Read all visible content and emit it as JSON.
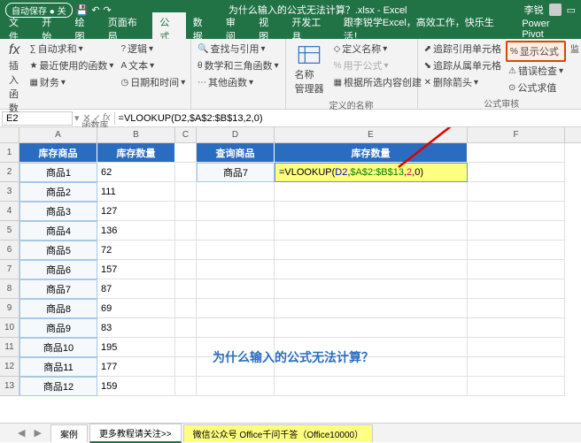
{
  "titlebar": {
    "autosave": "自动保存 ● 关",
    "filename": "为什么输入的公式无法计算？.xlsx - Excel",
    "user": "李锐"
  },
  "menu": {
    "file": "文件",
    "home": "开始",
    "insert": "绘图",
    "layout": "页面布局",
    "formula": "公式",
    "data": "数据",
    "review": "审阅",
    "view": "视图",
    "dev": "开发工具",
    "custom": "跟李锐学Excel，高效工作，快乐生活！",
    "power": "Power Pivot"
  },
  "ribbon": {
    "insertfn": "插入函数",
    "autosum": "自动求和",
    "recent": "最近使用的函数",
    "financial": "财务",
    "logical": "逻辑",
    "text": "文本",
    "date": "日期和时间",
    "lookup": "查找与引用",
    "math": "数学和三角函数",
    "more": "其他函数",
    "namemgr": "名称\n管理器",
    "define": "定义名称",
    "usefml": "用于公式",
    "fromsel": "根据所选内容创建",
    "traceprec": "追踪引用单元格",
    "tracedep": "追踪从属单元格",
    "removearrow": "删除箭头",
    "showfml": "显示公式",
    "errorcheck": "错误检查",
    "evaluate": "公式求值",
    "watch": "监",
    "g1": "函数库",
    "g2": "定义的名称",
    "g3": "公式审核"
  },
  "fb": {
    "ref": "E2",
    "formula": "=VLOOKUP(D2,$A$2:$B$13,2,0)"
  },
  "sheet": {
    "cols": [
      "A",
      "B",
      "C",
      "D",
      "E",
      "F"
    ],
    "h1": "库存商品",
    "h2": "库存数量",
    "h3": "查询商品",
    "h4": "库存数量",
    "rows": [
      {
        "a": "商品1",
        "b": "62"
      },
      {
        "a": "商品2",
        "b": "111"
      },
      {
        "a": "商品3",
        "b": "127"
      },
      {
        "a": "商品4",
        "b": "136"
      },
      {
        "a": "商品5",
        "b": "72"
      },
      {
        "a": "商品6",
        "b": "157"
      },
      {
        "a": "商品7",
        "b": "87"
      },
      {
        "a": "商品8",
        "b": "69"
      },
      {
        "a": "商品9",
        "b": "83"
      },
      {
        "a": "商品10",
        "b": "195"
      },
      {
        "a": "商品11",
        "b": "177"
      },
      {
        "a": "商品12",
        "b": "159"
      }
    ],
    "d2": "商品7",
    "e2": {
      "p1": "=VLOOKUP(",
      "p2": "D2",
      ",": ",",
      "p3": "$A$2:$B$13",
      "p4": "2",
      "p5": "0",
      "p6": ")"
    },
    "annotation": "为什么输入的公式无法计算？"
  },
  "tabs": {
    "t1": "案例",
    "t2": "更多教程请关注>>",
    "t3": "微信公众号 Office千问千答（Office10000）"
  }
}
